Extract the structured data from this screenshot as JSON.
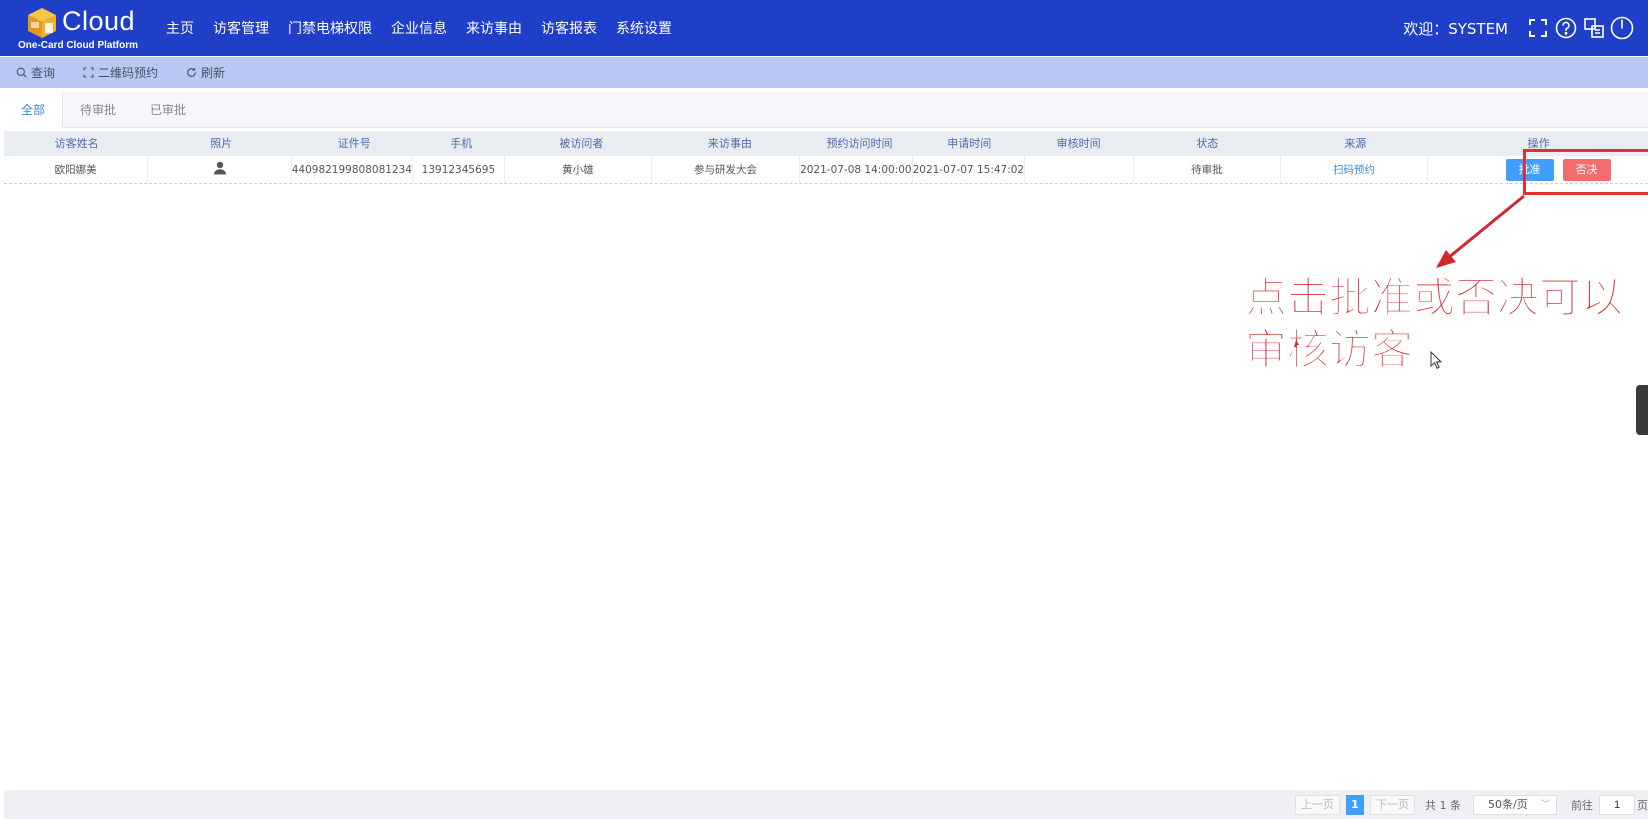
{
  "header": {
    "logo_word": "Cloud",
    "logo_sub": "One-Card Cloud Platform",
    "nav": [
      "主页",
      "访客管理",
      "门禁电梯权限",
      "企业信息",
      "来访事由",
      "访客报表",
      "系统设置"
    ],
    "welcome": "欢迎：SYSTEM"
  },
  "toolbar": {
    "query": "查询",
    "qr": "二维码预约",
    "refresh": "刷新"
  },
  "tabs": [
    "全部",
    "待审批",
    "已审批"
  ],
  "table": {
    "columns": [
      "访客姓名",
      "照片",
      "证件号",
      "手机",
      "被访问者",
      "来访事由",
      "预约访问时间",
      "申请时间",
      "审核时间",
      "状态",
      "来源",
      "操作"
    ],
    "rows": [
      {
        "name": "欧阳娜美",
        "id_no": "440982199808081234",
        "phone": "13912345695",
        "host": "黄小雄",
        "reason": "参与研发大会",
        "appointment": "2021-07-08 14:00:00",
        "applied": "2021-07-07 15:47:02",
        "reviewed": "",
        "status": "待审批",
        "source": "扫码预约",
        "approve": "批准",
        "reject": "否决"
      }
    ]
  },
  "annotation": {
    "line1": "点击批准或否决可以",
    "line2": "审核访客"
  },
  "pagination": {
    "prev": "上一页",
    "current": "1",
    "next": "下一页",
    "total": "共 1 条",
    "page_size": "50条/页",
    "goto_label": "前往",
    "goto_value": "1",
    "unit": "页"
  },
  "colors": {
    "header_bg": "#1f3fc8",
    "toolbar_bg": "#b9c7f3",
    "approve": "#409eff",
    "reject": "#f56c6c",
    "annotation": "#d0282c"
  }
}
